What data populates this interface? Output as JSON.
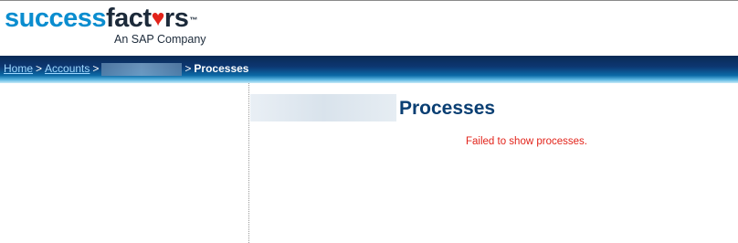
{
  "brand": {
    "logo_part1": "success",
    "logo_part2": "fact",
    "logo_heart": "♥",
    "logo_part3": "rs",
    "trademark": "™",
    "tagline": "An SAP Company",
    "colors": {
      "blue": "#0b8dcf",
      "dark": "#1c2a3a",
      "heart": "#e2231a"
    }
  },
  "breadcrumb": {
    "items": [
      {
        "label": "Home"
      },
      {
        "label": "Accounts"
      }
    ],
    "separator": ">",
    "current": "Processes"
  },
  "main": {
    "title": "Processes",
    "error_message": "Failed to show processes.",
    "error_color": "#e2231a",
    "title_color": "#0a3f73"
  }
}
